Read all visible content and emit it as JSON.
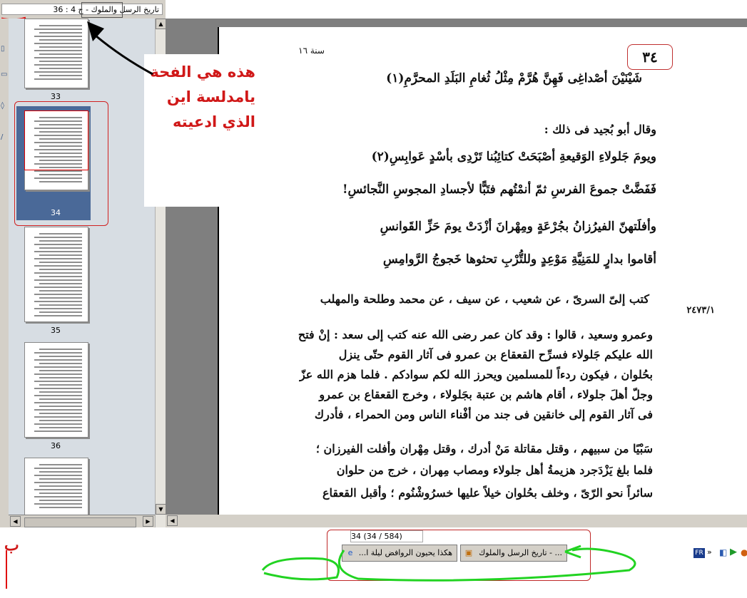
{
  "window": {
    "title": "تاريخ الرسل والملوك - ج 4 : 36"
  },
  "thumbnails": [
    {
      "label": "33"
    },
    {
      "label": "34"
    },
    {
      "label": "35"
    },
    {
      "label": "36"
    }
  ],
  "selected_page": "34",
  "page": {
    "header_year": "سنة ١٦",
    "page_number": "٣٤",
    "lines": [
      "شَيْنَيْنَ أصْداغِى فَهِنَّ هُرَّمْ     مِثْلُ ثُغامِ البَلَدِ المحرَّمِ(١)",
      "وقال أبو بُجيد فى ذلك :",
      "ويومَ جَلولاءِ الوَقيعةِ أصْبَحَتْ     كتائِبُنا تَرْدِى بأسْدٍ عَوابِسِ(٢)",
      "فَفَضَّتْ جموعَ الفرسِ ثمّ أنمْتُهم     فتَبًّا لأجسادِ المجوسِ النَّجائسِ!",
      "وأفلَتهنّ الفيرُزانُ بجُرْعَةٍ     ومِهْرانَ أزْدَتْ يومَ حَزِّ القَوانسِ",
      "أقاموا بدارٍ للمَنِيَّةِ مَوْعِدٍ     وللتُّرْبِ تحثوها خَجوجُ الرَّوامِسِ",
      "كتب إلىّ السرىّ ، عن شعيب ، عن سيف ، عن محمد وطلحة والمهلب",
      "وعمرو وسعيد ، قالوا : وقد كان عمر رضى الله عنه كتب إلى سعد : إنْ فتح",
      "الله عليكم جَلولاء فسرِّح القعقاع بن عمرو فى آثار القوم حتّى ينزل",
      "بحُلوان ، فيكون ردءاً للمسلمين ويحرز الله لكم سوادكم . فلما هزم الله عزّ",
      "وجلّ أهلَ جلولاء ، أقام هاشم بن عتبة بجَلولاء ، وخرج القعقاع بن عمرو",
      "فى آثار القوم إلى خانقين فى جند من أفْناء الناس ومن الحمراء ، فأدرك",
      "سَبْيًا من سبيهم ، وقتل مقاتلة مَنْ أدرك ، وقتل مِهْران وأفلت الفيرزان ؛",
      "فلما بلغ يَزْدَجرد هزيمةُ أهل جلولاء ومصاب مِهران ، خرج من حلوان",
      "سائراً نحو الرّىّ ، وخلف بحُلوان خيلاً عليها خسرُوشْنُوم ؛ وأقبل القعقاع"
    ],
    "side_ref": "٢٤٧٣/١"
  },
  "annotation": {
    "text": "هذه هي الفحة يامدلسة اين الذي ادعيته"
  },
  "taskbar": {
    "status": "34 (34 / 584)",
    "buttons": [
      {
        "label": "هكذا يحيون الروافض ليلة ا...",
        "icon": "ie-icon"
      },
      {
        "label": "... - تاريخ الرسل والملوك",
        "icon": "reader-icon"
      }
    ],
    "language": "FR",
    "tray_arrows": "»"
  },
  "marker_letter": "ب"
}
